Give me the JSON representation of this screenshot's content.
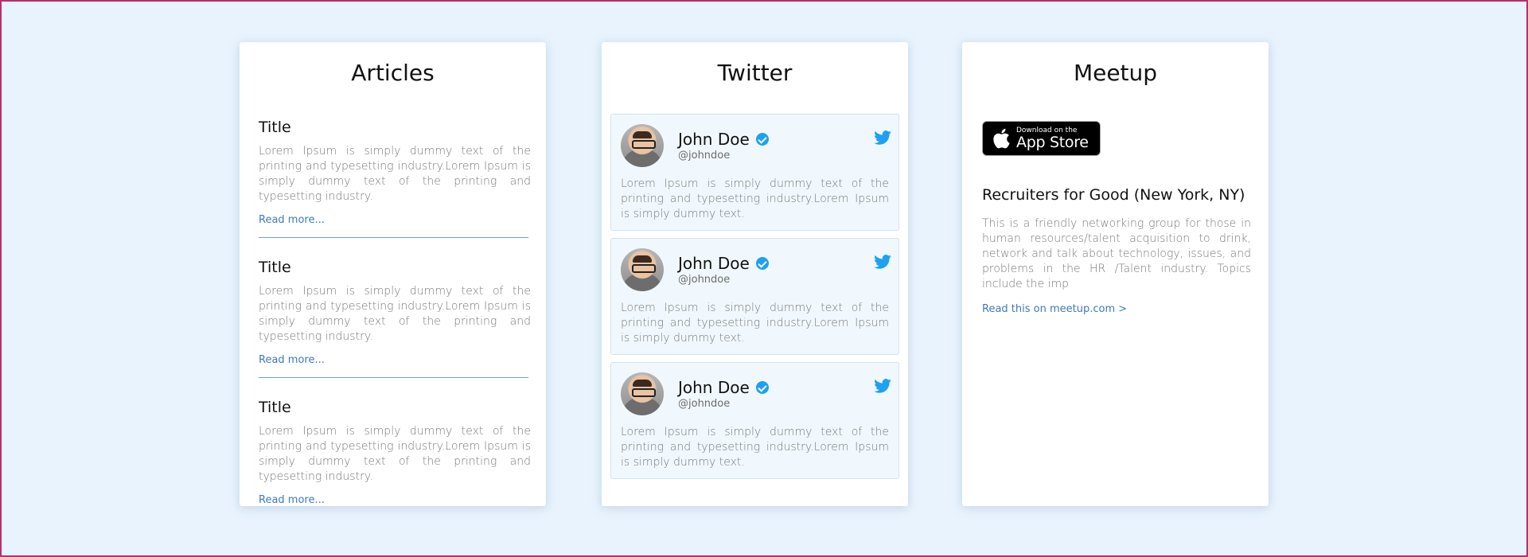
{
  "articles": {
    "title": "Articles",
    "items": [
      {
        "title": "Title",
        "text": "Lorem Ipsum is simply dummy text of the printing and typesetting industry.Lorem Ipsum is simply dummy text of the printing and typesetting industry.",
        "link": "Read more..."
      },
      {
        "title": "Title",
        "text": "Lorem Ipsum is simply dummy text of the printing and typesetting industry.Lorem Ipsum is simply dummy text of the printing and typesetting industry.",
        "link": "Read more..."
      },
      {
        "title": "Title",
        "text": "Lorem Ipsum is simply dummy text of the printing and typesetting industry.Lorem Ipsum is simply dummy text of the printing and typesetting industry.",
        "link": "Read more..."
      }
    ]
  },
  "twitter": {
    "title": "Twitter",
    "tweets": [
      {
        "name": "John Doe",
        "handle": "@johndoe",
        "text": "Lorem Ipsum is simply dummy text of the printing and typesetting industry.Lorem Ipsum is simply dummy text."
      },
      {
        "name": "John Doe",
        "handle": "@johndoe",
        "text": "Lorem Ipsum is simply dummy text of the printing and typesetting industry.Lorem Ipsum is simply dummy text."
      },
      {
        "name": "John Doe",
        "handle": "@johndoe",
        "text": "Lorem Ipsum is simply dummy text of the printing and typesetting industry.Lorem Ipsum is simply dummy text."
      }
    ]
  },
  "meetup": {
    "title": "Meetup",
    "appstore_small": "Download on the",
    "appstore_big": "App Store",
    "event_title": "Recruiters for Good (New York, NY)",
    "event_desc": "This is a friendly networking group for those in human resources/talent acquisition to drink, network and talk about technology, issues, and problems in the HR /Talent industry. Topics include the imp",
    "event_link": "Read this on meetup.com >"
  },
  "colors": {
    "page_background": "#e8f3fd",
    "page_border": "#b5306e",
    "link": "#3d7ab8",
    "twitter_blue": "#1da1f2"
  }
}
